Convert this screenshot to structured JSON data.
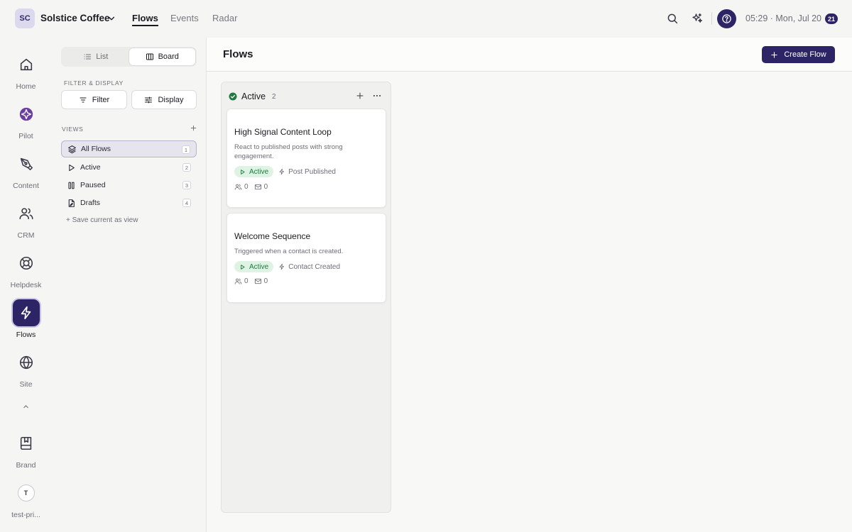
{
  "workspace": {
    "initials": "SC",
    "name": "Solstice Coffee"
  },
  "top_nav": {
    "tabs": [
      "Flows",
      "Events",
      "Radar"
    ]
  },
  "status": {
    "time": "05:29 · Mon, Jul 20",
    "notification_count": "21"
  },
  "rail": {
    "items": [
      "Home",
      "Pilot",
      "Content",
      "CRM",
      "Helpdesk",
      "Flows",
      "Site"
    ],
    "bottom": [
      "Brand",
      "test-pri..."
    ],
    "user_initial": "T"
  },
  "side_panel": {
    "layout_options": [
      "List",
      "Board"
    ],
    "filter_section_label": "FILTER & DISPLAY",
    "filter_label": "Filter",
    "display_label": "Display",
    "views_section_label": "VIEWS",
    "views": [
      {
        "label": "All Flows",
        "count": "1"
      },
      {
        "label": "Active",
        "count": "2"
      },
      {
        "label": "Paused",
        "count": "3"
      },
      {
        "label": "Drafts",
        "count": "4"
      }
    ],
    "save_view_label": "+ Save current as view"
  },
  "main": {
    "title": "Flows",
    "create_label": "Create Flow",
    "column": {
      "title": "Active",
      "count": "2"
    },
    "cards": [
      {
        "title": "High Signal Content Loop",
        "description": "React to published posts with strong engagement.",
        "status": "Active",
        "trigger": "Post Published",
        "contacts": "0",
        "messages": "0"
      },
      {
        "title": "Welcome Sequence",
        "description": "Triggered when a contact is created.",
        "status": "Active",
        "trigger": "Contact Created",
        "contacts": "0",
        "messages": "0"
      }
    ]
  },
  "colors": {
    "brand": "#2d2466",
    "success": "#1f7a3d",
    "success_bg": "#dff3e4"
  }
}
